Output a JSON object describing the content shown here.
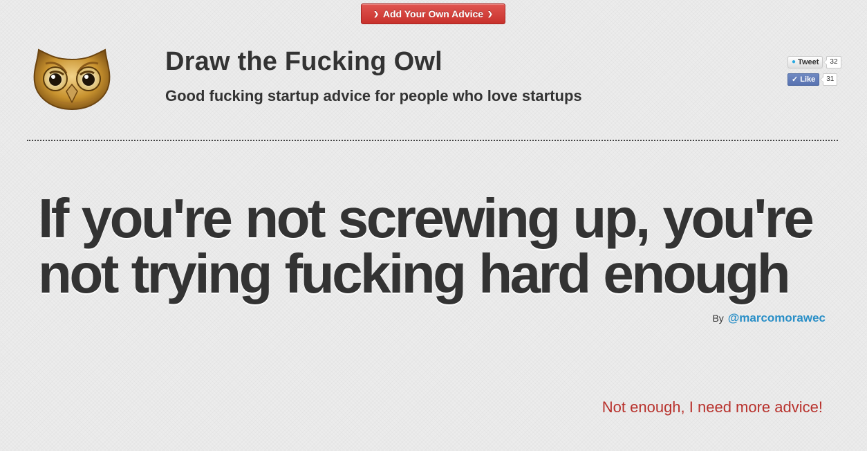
{
  "header": {
    "add_advice_label": "Add Your Own Advice",
    "add_advice_icon": "chevron-down-icon",
    "accent_color": "#d43f3a"
  },
  "site": {
    "title": "Draw the Fucking Owl",
    "tagline": "Good fucking startup advice for people who love startups",
    "logo_icon": "owl-icon"
  },
  "social": {
    "tweet_label": "Tweet",
    "tweet_count": "32",
    "like_label": "Like",
    "like_count": "31"
  },
  "advice": {
    "quote": "If you're not screwing up, you're not trying fucking hard enough",
    "by_label": "By",
    "author": "@marcomorawec",
    "author_color": "#2a8fc7"
  },
  "footer": {
    "more_label": "Not enough, I need more advice!",
    "more_color": "#b8312c"
  }
}
